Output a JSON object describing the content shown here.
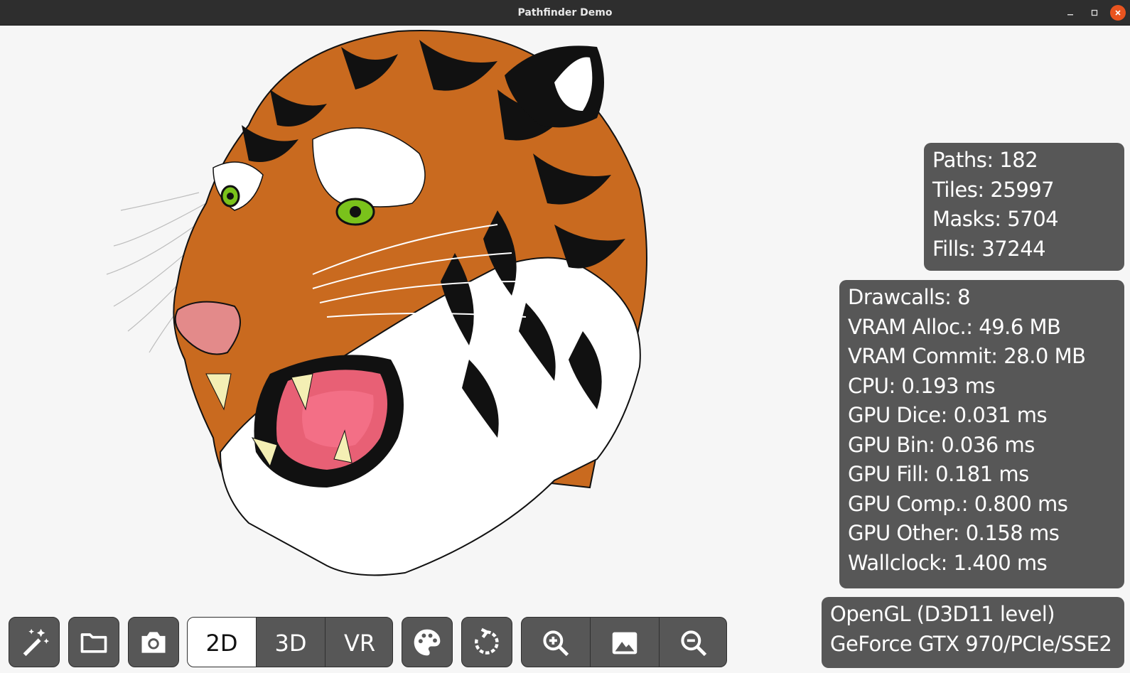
{
  "window": {
    "title": "Pathfinder Demo"
  },
  "stats": {
    "scene": [
      "Paths: 182",
      "Tiles: 25997",
      "Masks: 5704",
      "Fills: 37244"
    ],
    "timing": [
      "Drawcalls: 8",
      "VRAM Alloc.: 49.6 MB",
      "VRAM Commit: 28.0 MB",
      "CPU: 0.193 ms",
      "GPU Dice: 0.031 ms",
      "GPU Bin: 0.036 ms",
      "GPU Fill: 0.181 ms",
      "GPU Comp.: 0.800 ms",
      "GPU Other: 0.158 ms",
      "Wallclock: 1.400 ms"
    ],
    "device": [
      "OpenGL (D3D11 level)",
      "GeForce GTX 970/PCIe/SSE2"
    ]
  },
  "toolbar": {
    "mode_2d": "2D",
    "mode_3d": "3D",
    "mode_vr": "VR",
    "selected_mode": "2D",
    "icons": [
      "magic-wand-icon",
      "folder-icon",
      "camera-icon",
      "palette-icon",
      "rotate-icon",
      "zoom-in-icon",
      "image-icon",
      "zoom-out-icon"
    ]
  }
}
